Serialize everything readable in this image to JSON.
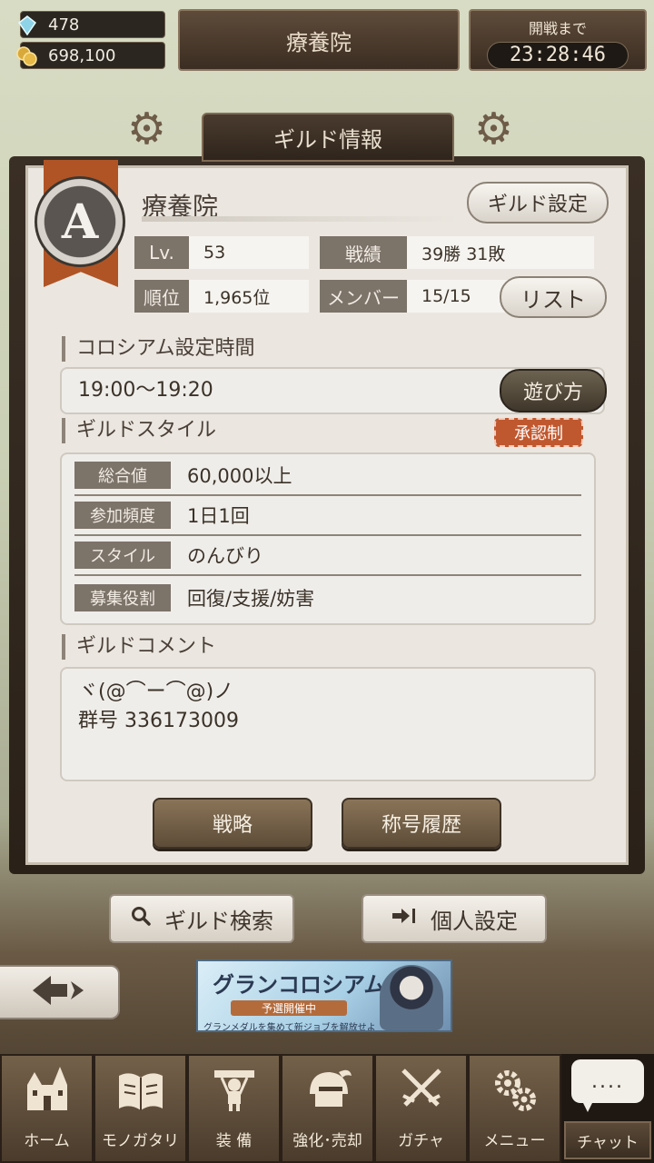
{
  "resources": {
    "gems": "478",
    "gold": "698,100"
  },
  "header": {
    "title": "療養院"
  },
  "timer": {
    "label": "開戦まで",
    "value": "23:28:46"
  },
  "panel": {
    "title": "ギルド情報"
  },
  "guild": {
    "rank_letter": "A",
    "name": "療養院",
    "settings_button": "ギルド設定",
    "stats": {
      "level_label": "Lv.",
      "level_value": "53",
      "record_label": "戦績",
      "record_value": "39勝 31敗",
      "rank_label": "順位",
      "rank_value": "1,965位",
      "members_label": "メンバー",
      "members_value": "15/15"
    },
    "list_button": "リスト"
  },
  "colosseum": {
    "section_label": "コロシアム設定時間",
    "time": "19:00〜19:20",
    "howto_button": "遊び方"
  },
  "guild_style": {
    "section_label": "ギルドスタイル",
    "badge": "承認制",
    "rows": [
      {
        "key": "総合値",
        "value": "60,000以上"
      },
      {
        "key": "参加頻度",
        "value": "1日1回"
      },
      {
        "key": "スタイル",
        "value": "のんびり"
      },
      {
        "key": "募集役割",
        "value": "回復/支援/妨害"
      }
    ]
  },
  "comment": {
    "section_label": "ギルドコメント",
    "text": "ヾ(@⌒ー⌒@)ノ\n群号 336173009"
  },
  "actions": {
    "strategy": "戦略",
    "title_history": "称号履歴"
  },
  "bottom_buttons": {
    "guild_search": "ギルド検索",
    "personal_settings": "個人設定"
  },
  "banner": {
    "title": "グランコロシアム",
    "subtitle": "予選開催中",
    "caption": "グランメダルを集めて新ジョブを解放せよ"
  },
  "nav": [
    {
      "label": "ホーム",
      "icon": "castle-icon"
    },
    {
      "label": "モノガタリ",
      "icon": "book-icon"
    },
    {
      "label": "装 備",
      "icon": "armor-icon"
    },
    {
      "label": "強化･売却",
      "icon": "helmet-icon"
    },
    {
      "label": "ガチャ",
      "icon": "swords-icon"
    },
    {
      "label": "メニュー",
      "icon": "gears-icon"
    }
  ],
  "chat": {
    "bubble": "....",
    "label": "チャット"
  },
  "colors": {
    "accent": "#c0582f",
    "panel_dark": "#2a2119",
    "panel_light": "#ebe7e0",
    "chip": "#7c7369"
  }
}
